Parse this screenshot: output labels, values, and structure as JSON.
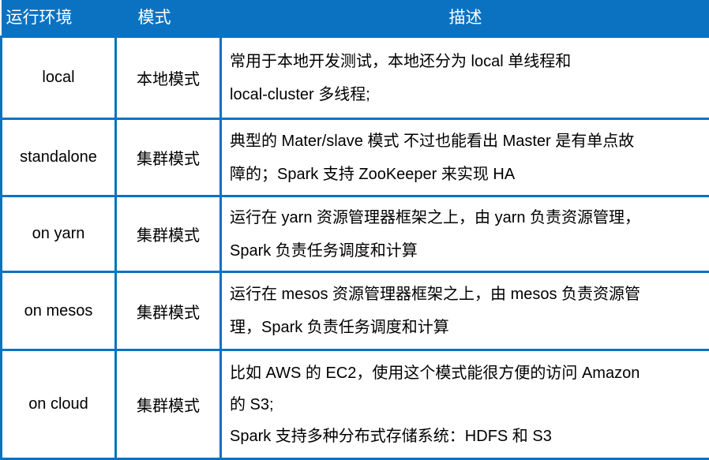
{
  "table": {
    "headers": {
      "environment": "运行环境",
      "mode": "模式",
      "description": "描述"
    },
    "rows": [
      {
        "environment": "local",
        "mode": "本地模式",
        "description_lines": [
          "常用于本地开发测试，本地还分为 local 单线程和",
          "local-cluster 多线程;"
        ]
      },
      {
        "environment": "standalone",
        "mode": "集群模式",
        "description_lines": [
          "典型的 Mater/slave 模式 不过也能看出 Master 是有单点故",
          "障的；Spark 支持 ZooKeeper 来实现 HA"
        ]
      },
      {
        "environment": "on yarn",
        "mode": "集群模式",
        "description_lines": [
          "运行在 yarn 资源管理器框架之上，由 yarn 负责资源管理，",
          "Spark 负责任务调度和计算"
        ]
      },
      {
        "environment": "on mesos",
        "mode": "集群模式",
        "description_lines": [
          "运行在 mesos 资源管理器框架之上，由 mesos 负责资源管",
          "理，Spark 负责任务调度和计算"
        ]
      },
      {
        "environment": "on cloud",
        "mode": "集群模式",
        "description_lines": [
          "比如 AWS 的 EC2，使用这个模式能很方便的访问 Amazon",
          "的 S3;",
          "Spark 支持多种分布式存储系统：HDFS 和 S3"
        ]
      }
    ]
  },
  "colors": {
    "header_background": "#0b72c2",
    "border": "#0b72c2",
    "header_text": "#ffffff",
    "body_text": "#000000",
    "cell_background": "#ffffff"
  }
}
